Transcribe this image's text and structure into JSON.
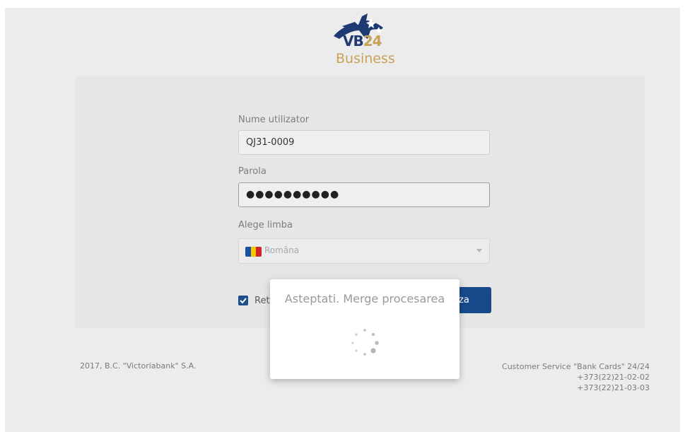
{
  "logo": {
    "vb": "VB",
    "num": "24",
    "business": "Business"
  },
  "form": {
    "username_label": "Nume utilizator",
    "username_value": "QJ31-0009",
    "password_label": "Parola",
    "password_mask": "●●●●●●●●●●",
    "language_label": "Alege limba",
    "language_value": "Româna",
    "remember_label": "Reti",
    "remember_checked": true,
    "submit_label": "za"
  },
  "modal": {
    "message": "Asteptati. Merge procesarea"
  },
  "footer": {
    "copyright": "2017, B.C. \"Victoriabank\" S.A.",
    "service_title": "Customer Service \"Bank Cards\" 24/24",
    "phone_1": "+373(22)21-02-02",
    "phone_2": "+373(22)21-03-03"
  },
  "colors": {
    "brand_blue": "#174a8b",
    "brand_gold": "#c9a257",
    "flag_blue": "#1d4fa3",
    "flag_yellow": "#f3c700",
    "flag_red": "#d2232a"
  }
}
